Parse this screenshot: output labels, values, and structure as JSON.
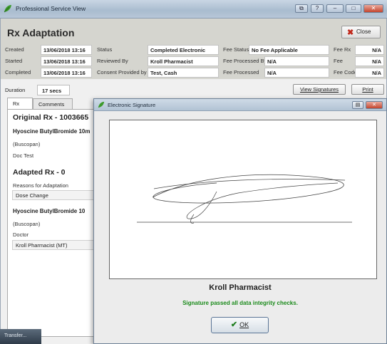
{
  "window": {
    "title": "Professional Service View"
  },
  "page_title": "Rx Adaptation",
  "close_label": "Close",
  "info": {
    "created_label": "Created",
    "created_value": "13/06/2018 13:16",
    "started_label": "Started",
    "started_value": "13/06/2018 13:16",
    "completed_label": "Completed",
    "completed_value": "13/06/2018 13:16",
    "status_label": "Status",
    "status_value": "Completed Electronic",
    "reviewed_label": "Reviewed By",
    "reviewed_value": "Kroll Pharmacist",
    "consent_label": "Consent Provided by",
    "consent_value": "Test, Cash",
    "fee_status_label": "Fee Status",
    "fee_status_value": "No Fee Applicable",
    "fee_processed_by_label": "Fee Processed By",
    "fee_processed_by_value": "N/A",
    "fee_processed_label": "Fee Processed",
    "fee_processed_value": "N/A",
    "fee_rx_label": "Fee Rx",
    "fee_rx_value": "N/A",
    "fee_label": "Fee",
    "fee_value": "N/A",
    "fee_code_label": "Fee Code",
    "fee_code_value": "N/A"
  },
  "duration_label": "Duration",
  "duration_value": "17 secs",
  "view_signatures_label": "View Signatures",
  "print_label": "Print",
  "tabs": [
    "Rx",
    "Comments"
  ],
  "rx": {
    "original_heading": "Original Rx - 1003665",
    "original_drug": "Hyoscine ButylBromide 10m",
    "original_brand": "(Buscopan)",
    "original_doc": "Doc Test",
    "adapted_heading": "Adapted Rx - 0",
    "reasons_label": "Reasons for Adaptation",
    "reason_value": "Dose Change",
    "adapted_drug": "Hyoscine ButylBromide 10",
    "adapted_brand": "(Buscopan)",
    "doctor_label": "Doctor",
    "doctor_value": "Kroll Pharmacist (MT)"
  },
  "taskbar_label": "Transfer...",
  "dialog": {
    "title": "Electronic Signature",
    "signer": "Kroll Pharmacist",
    "integrity_message": "Signature passed all data integrity checks.",
    "ok_label": "OK"
  },
  "colors": {
    "integrity_green": "#1a8a1a",
    "close_red": "#c0281b",
    "header_band": "#d5d5cf"
  }
}
